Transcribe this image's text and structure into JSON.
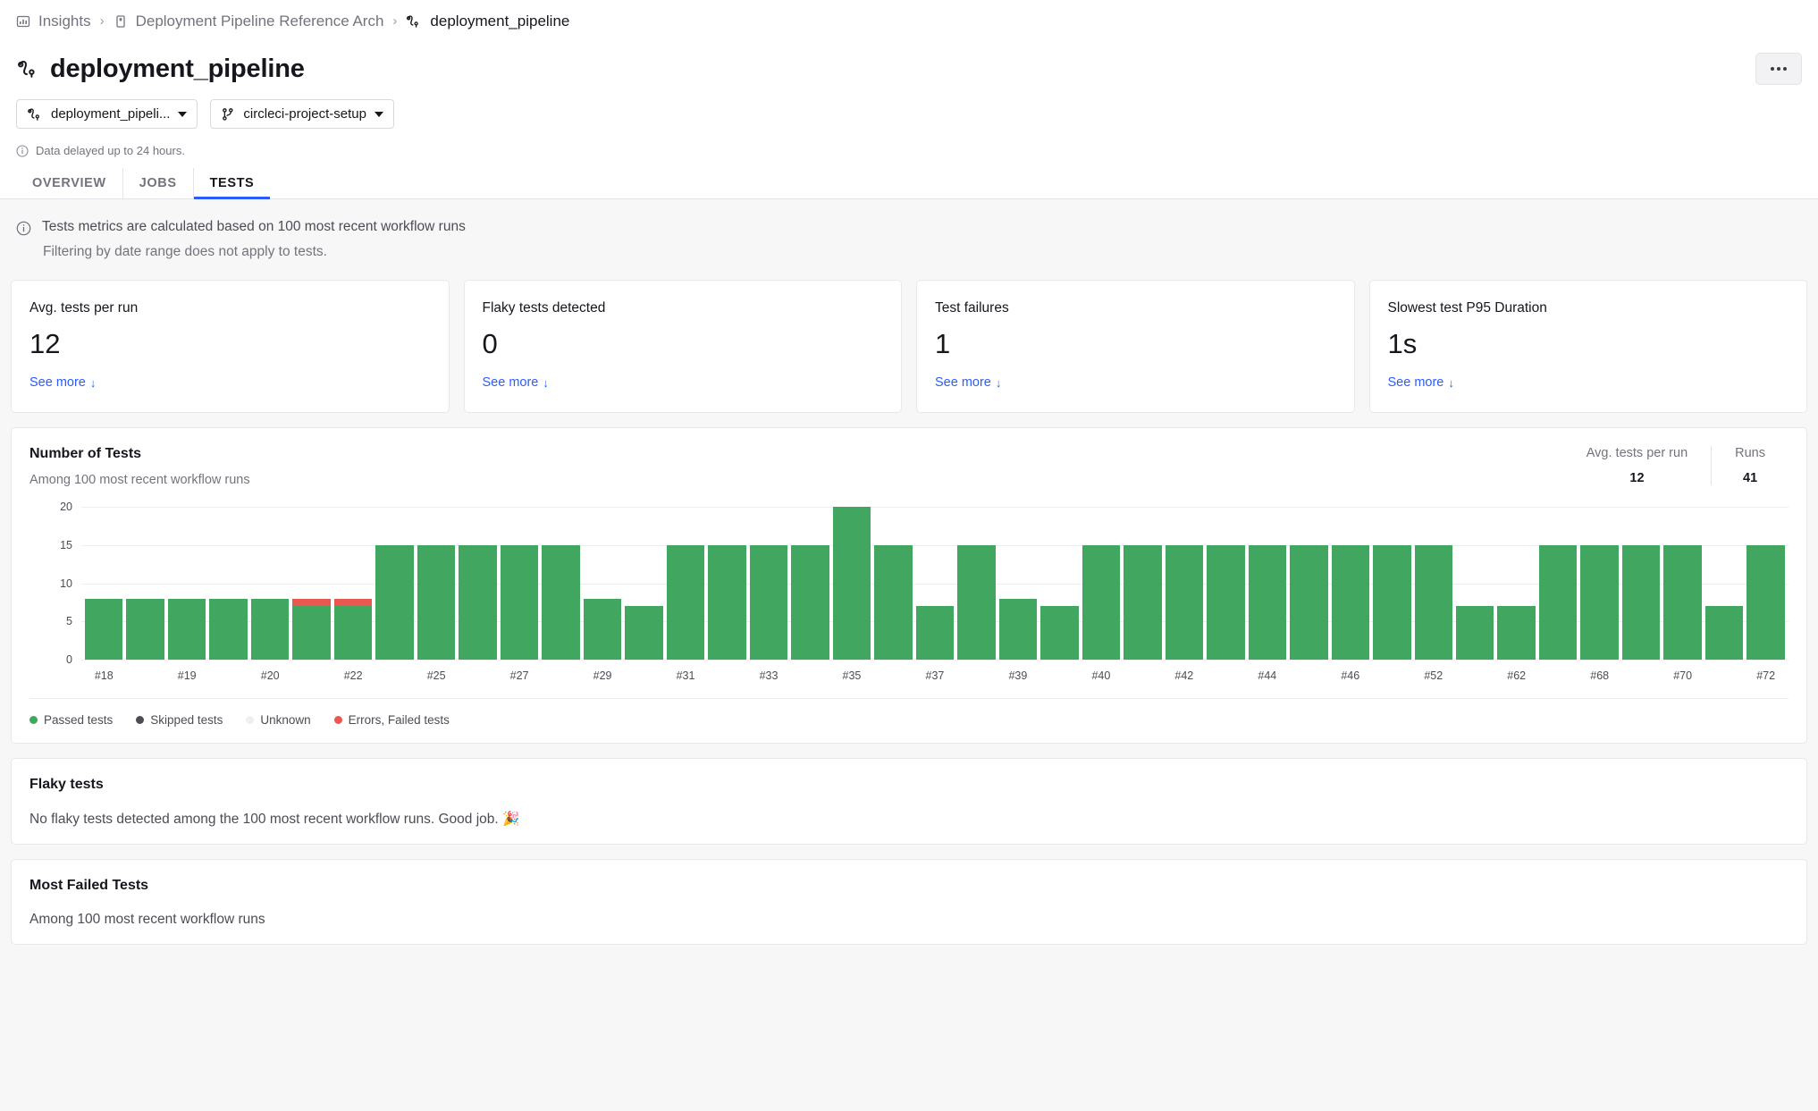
{
  "breadcrumb": {
    "insights": "Insights",
    "org": "Deployment Pipeline Reference Arch",
    "current": "deployment_pipeline",
    "separator": "›"
  },
  "header": {
    "title": "deployment_pipeline",
    "kebab_name": "more-options"
  },
  "selectors": {
    "workflow": "deployment_pipeli...",
    "branch": "circleci-project-setup"
  },
  "delay_note": "Data delayed up to 24 hours.",
  "tabs": [
    {
      "label": "OVERVIEW",
      "active": false
    },
    {
      "label": "JOBS",
      "active": false
    },
    {
      "label": "TESTS",
      "active": true
    }
  ],
  "info": {
    "line1": "Tests metrics are calculated based on 100 most recent workflow runs",
    "line2": "Filtering by date range does not apply to tests."
  },
  "cards": [
    {
      "label": "Avg. tests per run",
      "value": "12",
      "link": "See more"
    },
    {
      "label": "Flaky tests detected",
      "value": "0",
      "link": "See more"
    },
    {
      "label": "Test failures",
      "value": "1",
      "link": "See more"
    },
    {
      "label": "Slowest test P95 Duration",
      "value": "1s",
      "link": "See more"
    }
  ],
  "chart_panel": {
    "title": "Number of Tests",
    "subtitle": "Among 100 most recent workflow runs",
    "stats": [
      {
        "label": "Avg. tests per run",
        "value": "12"
      },
      {
        "label": "Runs",
        "value": "41"
      }
    ]
  },
  "chart_data": {
    "type": "bar",
    "title": "Number of Tests",
    "subtitle": "Among 100 most recent workflow runs",
    "xlabel": "",
    "ylabel": "",
    "ylim": [
      0,
      20
    ],
    "yticks": [
      0,
      5,
      10,
      15,
      20
    ],
    "grid": true,
    "stacked": true,
    "legend_position": "bottom",
    "colors": {
      "passed": "#40a660",
      "skipped": "#4c4c55",
      "unknown": "#efeff2",
      "failed": "#e8584f"
    },
    "legend": [
      {
        "name": "Passed tests",
        "color": "#40a660"
      },
      {
        "name": "Skipped tests",
        "color": "#4c4c55"
      },
      {
        "name": "Unknown",
        "color": "#efeff2"
      },
      {
        "name": "Errors, Failed tests",
        "color": "#e8584f"
      }
    ],
    "categories": [
      "#18",
      "",
      "#19",
      "",
      "#20",
      "",
      "#22",
      "",
      "#25",
      "",
      "#27",
      "",
      "#29",
      "",
      "#31",
      "",
      "#33",
      "",
      "#35",
      "",
      "#37",
      "",
      "#39",
      "",
      "#40",
      "",
      "#42",
      "",
      "#44",
      "",
      "#46",
      "",
      "#52",
      "",
      "#62",
      "",
      "#68",
      "",
      "#70",
      "",
      "#72"
    ],
    "tick_labels": [
      "#18",
      "#19",
      "#20",
      "#22",
      "#25",
      "#27",
      "#29",
      "#31",
      "#33",
      "#35",
      "#37",
      "#39",
      "#40",
      "#42",
      "#44",
      "#46",
      "#52",
      "#62",
      "#68",
      "#70",
      "#72"
    ],
    "series": [
      {
        "name": "Passed tests",
        "color": "#40a660",
        "values": [
          8,
          8,
          8,
          8,
          8,
          7,
          7,
          15,
          15,
          15,
          15,
          15,
          8,
          7,
          15,
          15,
          15,
          15,
          20,
          15,
          7,
          15,
          8,
          7,
          15,
          15,
          15,
          15,
          15,
          15,
          15,
          15,
          15,
          7,
          7,
          15,
          15,
          15,
          15,
          7,
          15
        ]
      },
      {
        "name": "Errors, Failed tests",
        "color": "#e8584f",
        "values": [
          0,
          0,
          0,
          0,
          0,
          1,
          1,
          0,
          0,
          0,
          0,
          0,
          0,
          0,
          0,
          0,
          0,
          0,
          0,
          0,
          0,
          0,
          0,
          0,
          0,
          0,
          0,
          0,
          0,
          0,
          0,
          0,
          0,
          0,
          0,
          0,
          0,
          0,
          0,
          0,
          0
        ]
      }
    ],
    "totals": [
      8,
      8,
      8,
      8,
      8,
      8,
      8,
      15,
      15,
      15,
      15,
      15,
      8,
      7,
      15,
      15,
      15,
      15,
      20,
      15,
      7,
      15,
      8,
      7,
      15,
      15,
      15,
      15,
      15,
      15,
      15,
      15,
      15,
      7,
      7,
      15,
      15,
      15,
      15,
      7,
      15
    ]
  },
  "flaky_panel": {
    "title": "Flaky tests",
    "body": "No flaky tests detected among the 100 most recent workflow runs. Good job. 🎉"
  },
  "failed_panel": {
    "title": "Most Failed Tests",
    "body": "Among 100 most recent workflow runs"
  }
}
